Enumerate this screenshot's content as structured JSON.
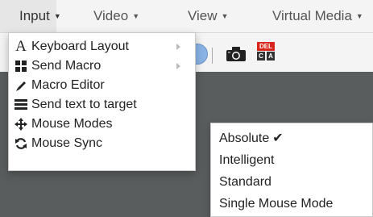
{
  "menubar": {
    "items": [
      {
        "label": "Input",
        "active": true
      },
      {
        "label": "Video"
      },
      {
        "label": "View"
      },
      {
        "label": "Virtual Media"
      }
    ]
  },
  "toolbar": {
    "del_key": "DEL",
    "ctrl_key": "C",
    "alt_key": "A"
  },
  "input_menu": {
    "items": [
      {
        "label": "Keyboard Layout",
        "icon": "letter-a-icon",
        "icon_glyph": "A",
        "submenu": true
      },
      {
        "label": "Send Macro",
        "icon": "grid-icon",
        "submenu": true
      },
      {
        "label": "Macro Editor",
        "icon": "pencil-icon"
      },
      {
        "label": "Send text to target",
        "icon": "lines-icon"
      },
      {
        "label": "Mouse Modes",
        "icon": "move-arrows-icon"
      },
      {
        "label": "Mouse Sync",
        "icon": "refresh-icon"
      }
    ]
  },
  "mouse_modes": {
    "items": [
      {
        "label": "Absolute",
        "checked": true
      },
      {
        "label": "Intelligent"
      },
      {
        "label": "Standard"
      },
      {
        "label": "Single Mouse Mode"
      }
    ],
    "check_glyph": "✔"
  },
  "colors": {
    "menubar_bg": "#f4f4f4",
    "active_menu_bg": "#e6e6e6",
    "viewer_bg": "#5a5d5e",
    "del_red": "#d9261c",
    "ctrl_dark": "#333333"
  }
}
